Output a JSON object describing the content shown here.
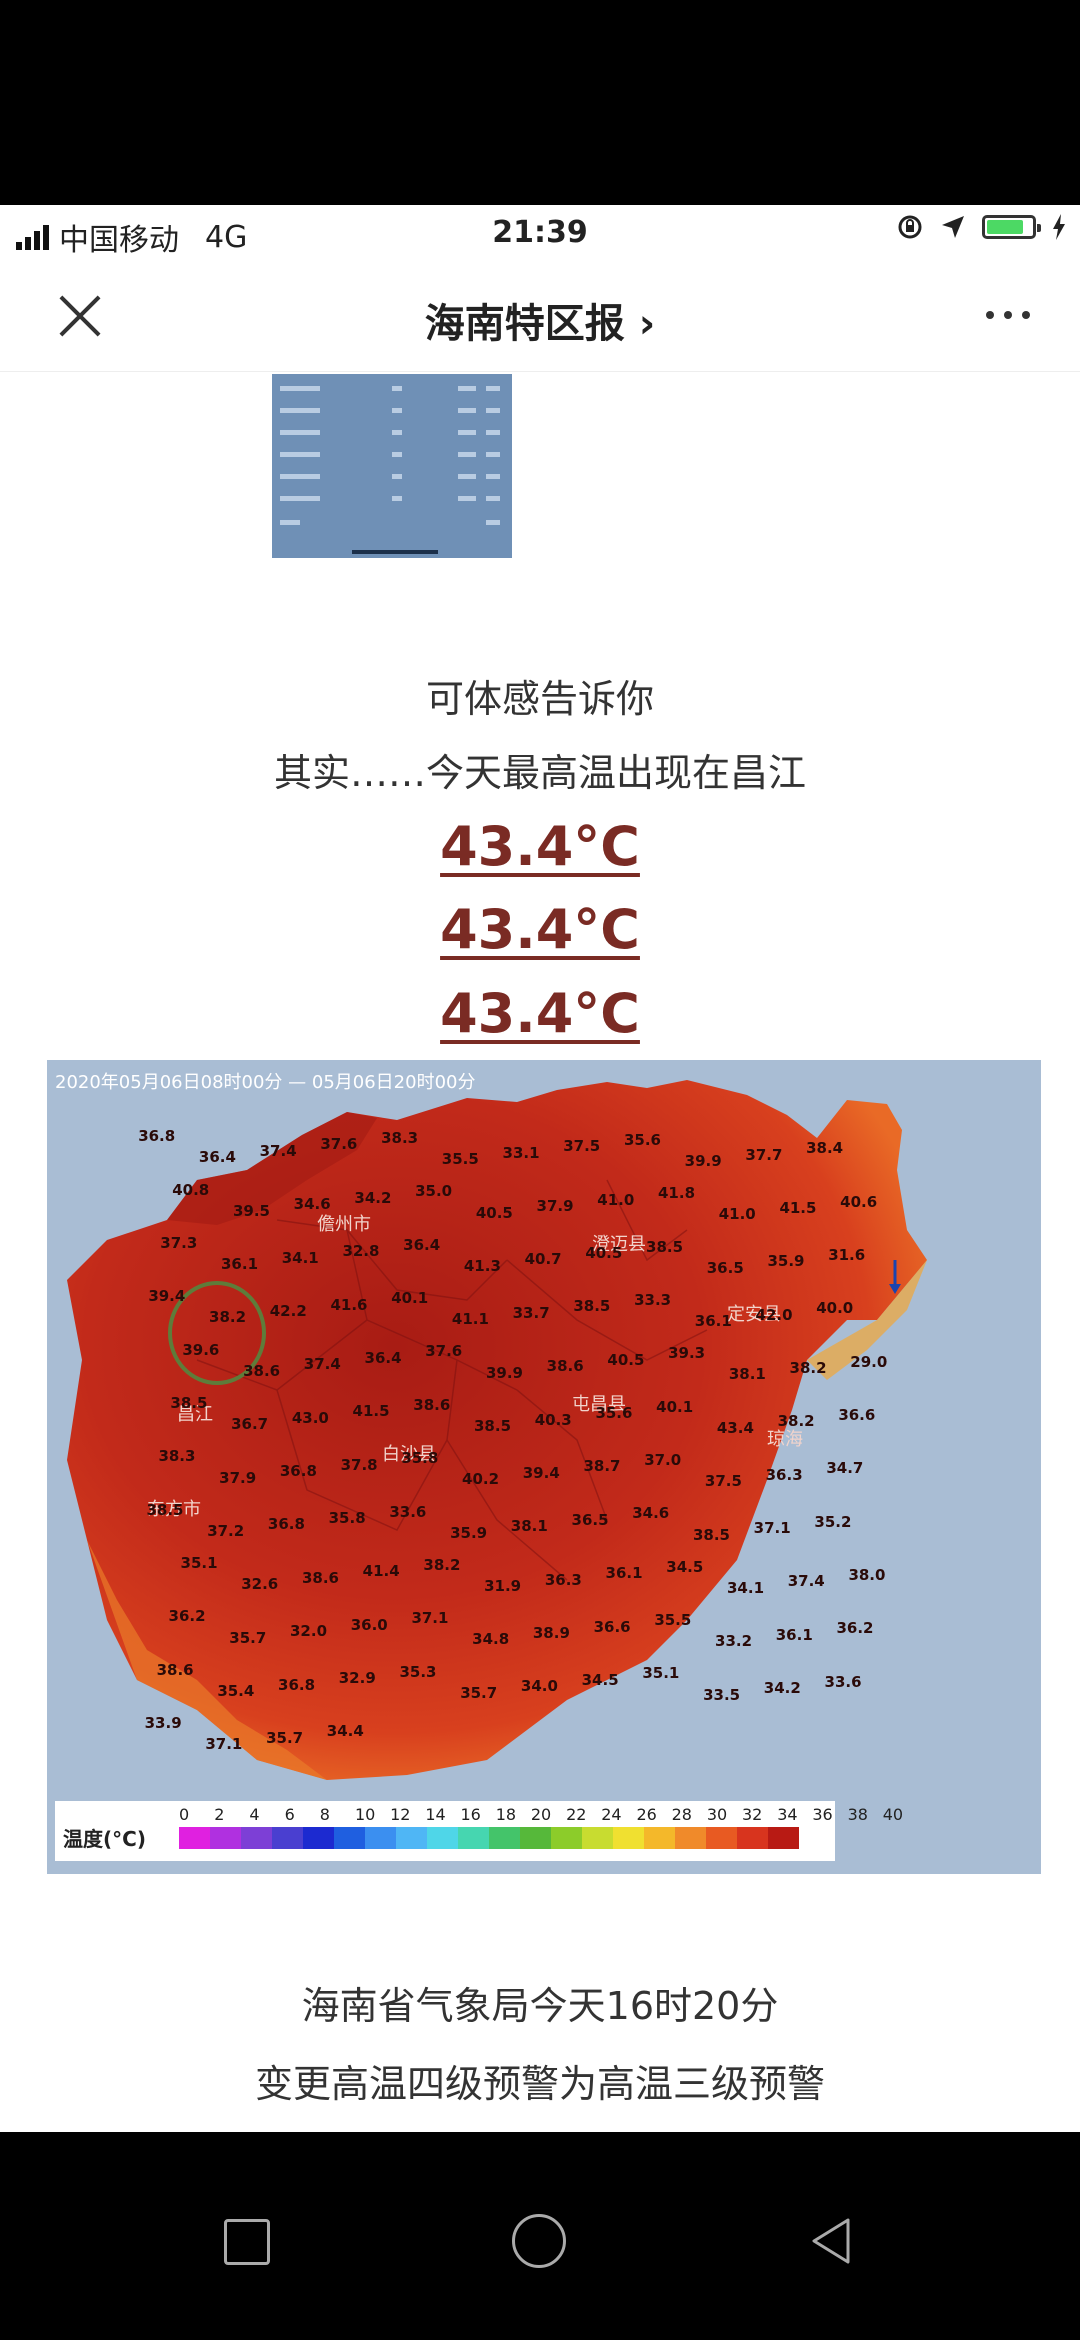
{
  "status_bar": {
    "carrier": "中国移动",
    "network": "4G",
    "time": "21:39"
  },
  "nav": {
    "title": "海南特区报 ›"
  },
  "article": {
    "line1": "可体感告诉你",
    "line2": "其实……今天最高温出现在昌江",
    "temps": [
      "43.4°C",
      "43.4°C",
      "43.4°C"
    ],
    "map": {
      "time_range": "2020年05月06日08时00分 — 05月06日20时00分",
      "regions": [
        "儋州市",
        "澄迈县",
        "定安县",
        "昌江",
        "白沙县",
        "屯昌县",
        "琼海",
        "东方市"
      ],
      "readings": [
        "36.8",
        "36.4",
        "37.4",
        "37.6",
        "38.3",
        "35.5",
        "33.1",
        "37.5",
        "35.6",
        "39.9",
        "37.7",
        "38.4",
        "40.8",
        "39.5",
        "34.6",
        "34.2",
        "35.0",
        "40.5",
        "37.9",
        "41.0",
        "41.8",
        "41.0",
        "41.5",
        "40.6",
        "37.3",
        "36.1",
        "34.1",
        "32.8",
        "36.4",
        "41.3",
        "40.7",
        "40.5",
        "38.5",
        "36.5",
        "35.9",
        "31.6",
        "39.4",
        "38.2",
        "42.2",
        "41.6",
        "40.1",
        "41.1",
        "33.7",
        "38.5",
        "33.3",
        "36.1",
        "42.0",
        "40.0",
        "39.6",
        "38.6",
        "37.4",
        "36.4",
        "37.6",
        "39.9",
        "38.6",
        "40.5",
        "39.3",
        "38.1",
        "38.2",
        "29.0",
        "38.5",
        "36.7",
        "43.0",
        "41.5",
        "38.6",
        "38.5",
        "40.3",
        "35.6",
        "40.1",
        "43.4",
        "38.2",
        "36.6",
        "38.3",
        "37.9",
        "36.8",
        "37.8",
        "35.8",
        "40.2",
        "39.4",
        "38.7",
        "37.0",
        "37.5",
        "36.3",
        "34.7",
        "38.5",
        "37.2",
        "36.8",
        "35.8",
        "33.6",
        "35.9",
        "38.1",
        "36.5",
        "34.6",
        "38.5",
        "37.1",
        "35.2",
        "35.1",
        "32.6",
        "38.6",
        "41.4",
        "38.2",
        "31.9",
        "36.3",
        "36.1",
        "34.5",
        "34.1",
        "37.4",
        "38.0",
        "36.2",
        "35.7",
        "32.0",
        "36.0",
        "37.1",
        "34.8",
        "38.9",
        "36.6",
        "35.5",
        "33.2",
        "36.1",
        "36.2",
        "38.6",
        "35.4",
        "36.8",
        "32.9",
        "35.3",
        "35.7",
        "34.0",
        "34.5",
        "35.1",
        "33.5",
        "34.2",
        "33.6",
        "33.9",
        "37.1",
        "35.7",
        "34.4"
      ]
    },
    "legend": {
      "title": "温度(°C)",
      "ticks": [
        "0",
        "2",
        "4",
        "6",
        "8",
        "10",
        "12",
        "14",
        "16",
        "18",
        "20",
        "22",
        "24",
        "26",
        "28",
        "30",
        "32",
        "34",
        "36",
        "38",
        "40"
      ],
      "colors": [
        "#e020e0",
        "#b030e0",
        "#7d3fd6",
        "#4a3fd0",
        "#1c2ad0",
        "#1f5fe0",
        "#3b8ff0",
        "#4fb6f5",
        "#4fd6e8",
        "#46d6b0",
        "#44c46a",
        "#56b83a",
        "#8ccc2a",
        "#c8dc30",
        "#f0e030",
        "#f4b82a",
        "#f08a2a",
        "#e85a22",
        "#d8341e",
        "#b81a14"
      ]
    },
    "line3": "海南省气象局今天16时20分",
    "line4": "变更高温四级预警为高温三级预警"
  }
}
